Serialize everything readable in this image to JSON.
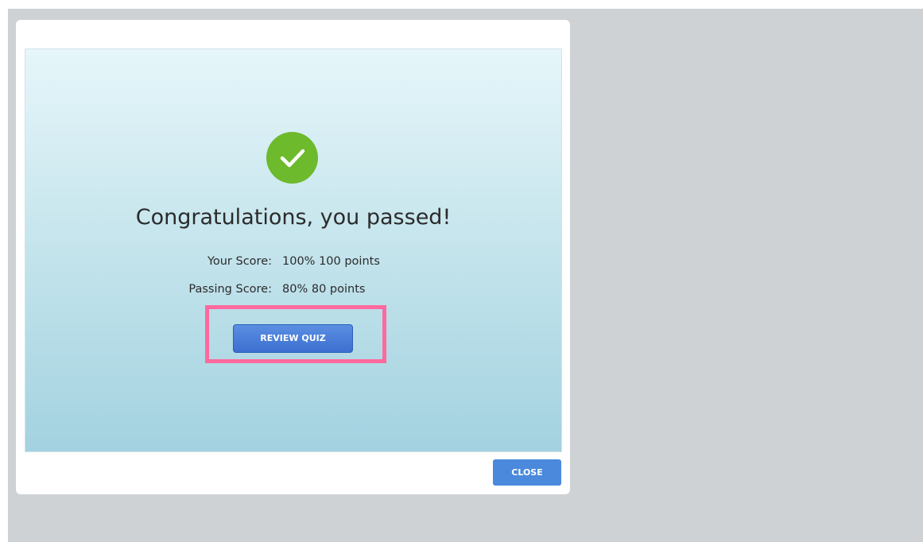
{
  "result": {
    "status_icon": "checkmark-icon",
    "headline": "Congratulations, you passed!",
    "your_score_label": "Your Score:",
    "your_score_value": "100% 100 points",
    "passing_score_label": "Passing Score:",
    "passing_score_value": "80% 80 points",
    "review_button_label": "REVIEW QUIZ"
  },
  "modal": {
    "close_button_label": "CLOSE"
  },
  "colors": {
    "success_green": "#6dba2c",
    "button_blue": "#4a89dc",
    "highlight_pink": "#ff6a9e",
    "backdrop_gray": "#ced2d5"
  }
}
